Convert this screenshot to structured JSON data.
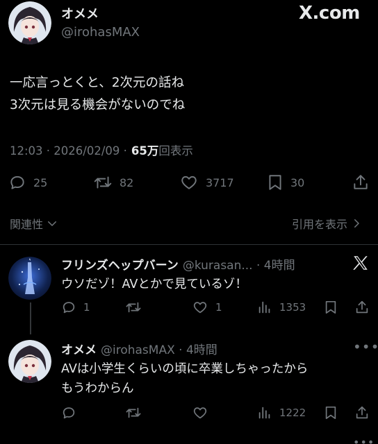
{
  "main_tweet": {
    "display_name": "オメメ",
    "handle": "@irohasMAX",
    "text": "一応言っとくと、2次元の話ね\n3次元は見る機会がないのでね",
    "time": "12:03 · 2026/02/09 ·",
    "views_count": "65万",
    "views_label": "回表示",
    "stats": {
      "replies": "25",
      "reposts": "82",
      "likes": "3717",
      "bookmarks": "30"
    }
  },
  "brand": {
    "logo_text": "X.com"
  },
  "related": {
    "label": "関連性",
    "quotes_label": "引用を表示"
  },
  "replies": [
    {
      "display_name": "フリンズヘップバーン",
      "handle_time": "@kurasan... · 4時間",
      "text": "ウソだゾ！AVとかで見ているゾ！",
      "stats": {
        "replies": "1",
        "reposts": "",
        "likes": "1",
        "views": "1353"
      }
    },
    {
      "display_name": "オメメ",
      "handle_time": "@irohasMAX · 4時間",
      "text": "AVは小学生くらいの頃に卒業しちゃったから\nもうわからん",
      "stats": {
        "replies": "",
        "reposts": "",
        "likes": "",
        "views": "1222"
      }
    }
  ],
  "colors": {
    "background": "#000000",
    "text": "#e7e9ea",
    "muted": "#71767b",
    "divider": "#2f3336"
  }
}
